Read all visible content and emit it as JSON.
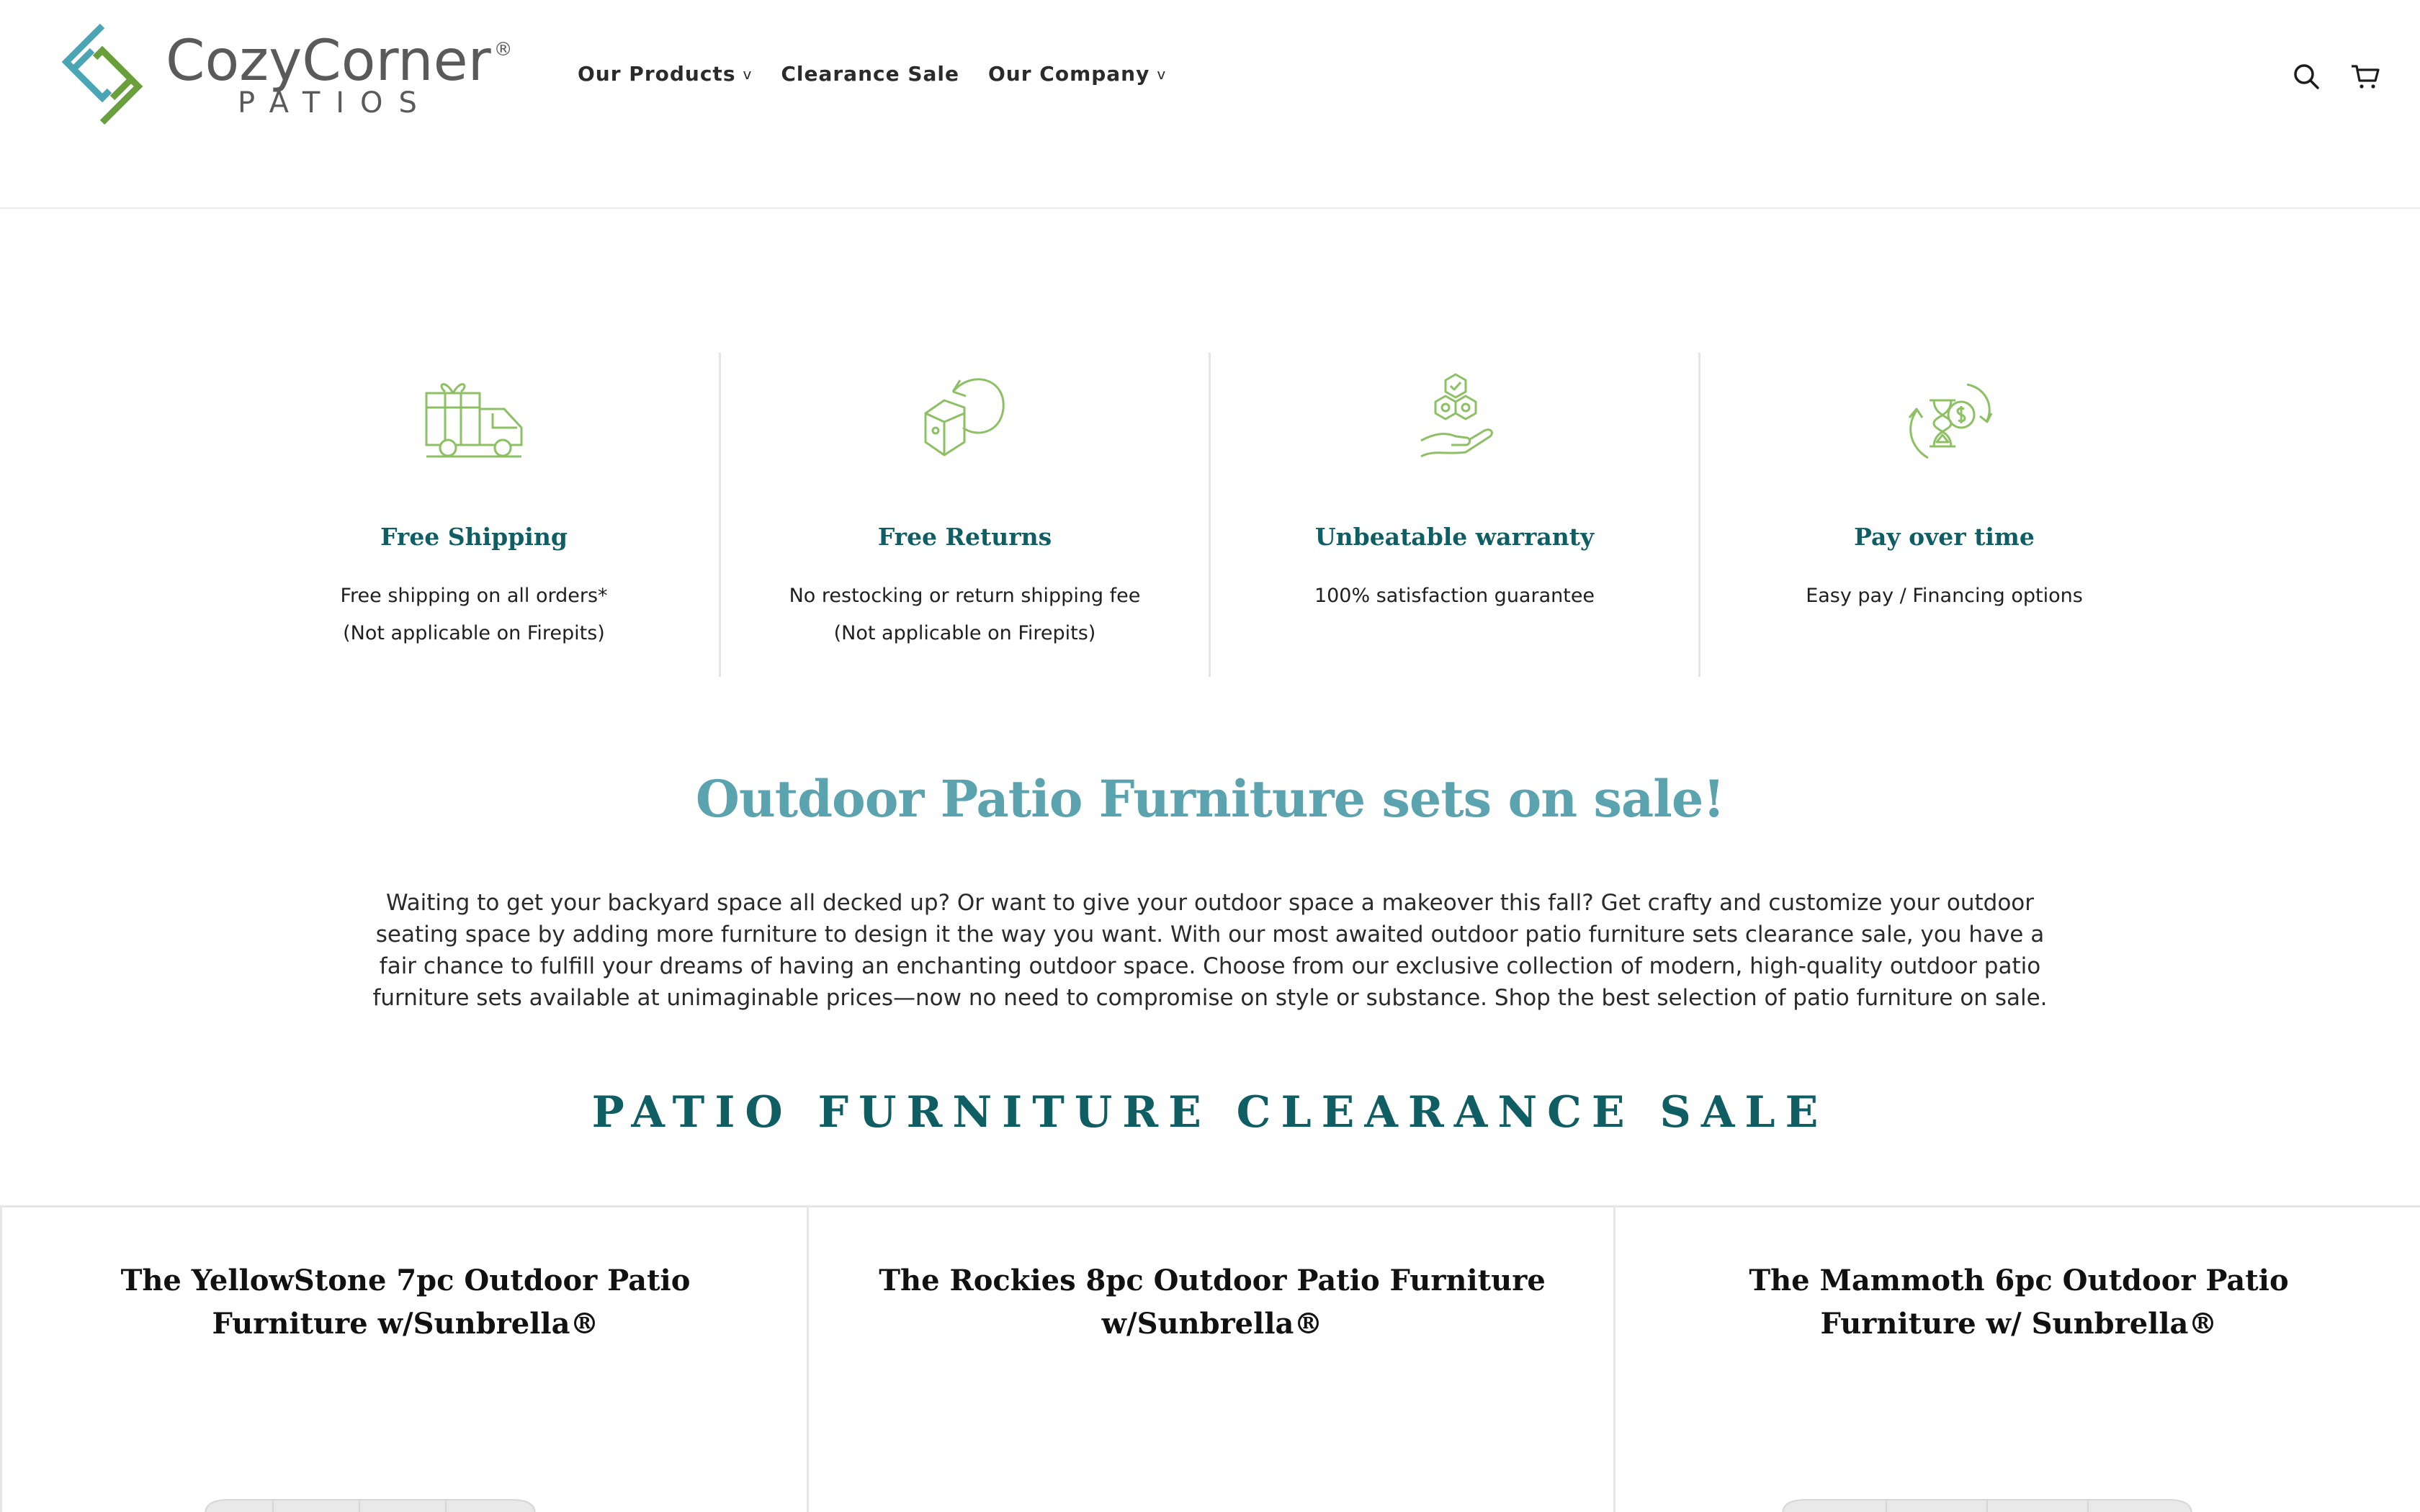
{
  "brand": {
    "name": "CozyCorner",
    "reg_mark": "®",
    "subtitle": "PATIOS",
    "colors": {
      "teal": "#4aa5b5",
      "green": "#6aa03c",
      "dark_teal": "#0f5e63",
      "light_teal": "#5aa3af",
      "icon_green": "#8cc063"
    }
  },
  "nav": {
    "items": [
      {
        "label": "Our Products",
        "caret": "v"
      },
      {
        "label": "Clearance Sale",
        "caret": ""
      },
      {
        "label": "Our Company",
        "caret": "v"
      }
    ]
  },
  "header_icons": {
    "search": "search-icon",
    "cart": "cart-icon"
  },
  "features": [
    {
      "icon": "delivery-truck-gift-icon",
      "title": "Free Shipping",
      "line1": "Free shipping on all orders*",
      "line2": "(Not applicable on Firepits)"
    },
    {
      "icon": "return-box-icon",
      "title": "Free Returns",
      "line1": "No restocking or return shipping fee",
      "line2": "(Not applicable on Firepits)"
    },
    {
      "icon": "warranty-hand-icon",
      "title": "Unbeatable warranty",
      "line1": "100% satisfaction guarantee",
      "line2": ""
    },
    {
      "icon": "pay-over-time-icon",
      "title": "Pay over time",
      "line1": "Easy pay / Financing options",
      "line2": ""
    }
  ],
  "promo": {
    "title": "Outdoor Patio Furniture sets on sale!",
    "copy": "Waiting to get your backyard space all decked up? Or want to give your outdoor space a makeover this fall? Get crafty and customize your outdoor seating space by adding more furniture to design it the way you want. With our most awaited outdoor patio furniture sets clearance sale, you have a fair chance to fulfill your dreams of having an enchanting outdoor space. Choose from our exclusive collection of modern, high-quality outdoor patio furniture sets available at unimaginable prices—now no need to compromise on style or substance. Shop the best selection of patio furniture on sale."
  },
  "sale_heading": "PATIO FURNITURE CLEARANCE SALE",
  "products": [
    {
      "title": "The YellowStone 7pc Outdoor Patio Furniture w/Sunbrella®"
    },
    {
      "title": "The Rockies 8pc Outdoor Patio Furniture w/Sunbrella®"
    },
    {
      "title": "The Mammoth 6pc Outdoor Patio Furniture w/ Sunbrella®"
    }
  ]
}
